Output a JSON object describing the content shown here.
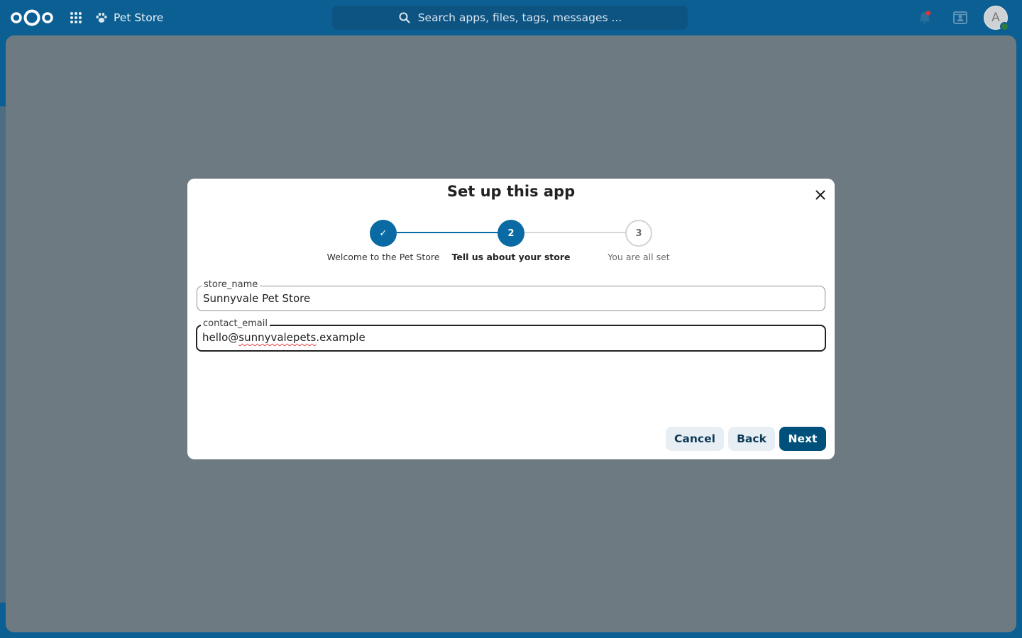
{
  "header": {
    "app_name": "Pet Store",
    "search_placeholder": "Search apps, files, tags, messages ...",
    "avatar_initial": "A",
    "icons": [
      "nextcloud-logo",
      "apps-grid-icon",
      "paw-icon",
      "search-icon",
      "notifications-icon",
      "contacts-icon"
    ]
  },
  "modal": {
    "title": "Set up this app",
    "steps": [
      {
        "marker": "✓",
        "label": "Welcome to the Pet Store",
        "state": "done"
      },
      {
        "marker": "2",
        "label": "Tell us about your store",
        "state": "current"
      },
      {
        "marker": "3",
        "label": "You are all set",
        "state": "todo"
      }
    ],
    "fields": [
      {
        "label": "store_name",
        "value": "Sunnyvale Pet Store"
      },
      {
        "label": "contact_email",
        "value_prefix": "hello@",
        "value_underlined": "sunnyvalepets",
        "value_suffix": ".example"
      }
    ],
    "buttons": {
      "cancel": "Cancel",
      "back": "Back",
      "next": "Next"
    }
  },
  "colors": {
    "header_bg": "#0b5f92",
    "primary": "#00507c",
    "step_done": "#0a6aa3",
    "notification_dot": "#e9322d"
  }
}
